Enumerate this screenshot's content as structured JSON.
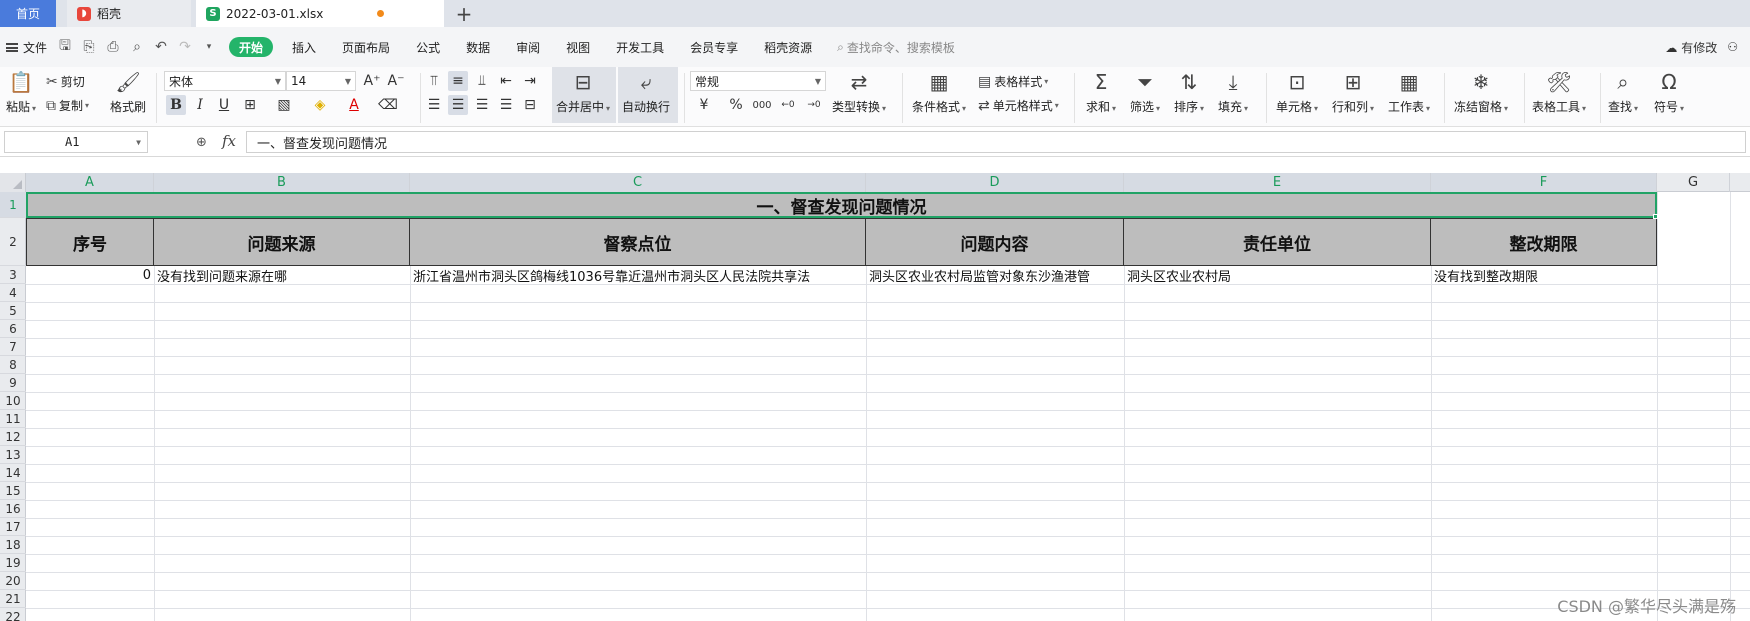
{
  "tabs": {
    "home": "首页",
    "daoke": "稻壳",
    "file": "2022-03-01.xlsx",
    "add": "+"
  },
  "menu": {
    "file": "文件",
    "items": [
      "开始",
      "插入",
      "页面布局",
      "公式",
      "数据",
      "审阅",
      "视图",
      "开发工具",
      "会员专享",
      "稻壳资源"
    ],
    "search": "查找命令、搜索模板",
    "modified": "有修改"
  },
  "ribbon": {
    "paste": "粘贴",
    "cut": "剪切",
    "copy": "复制",
    "format_painter": "格式刷",
    "font_name": "宋体",
    "font_size": "14",
    "merge_center": "合并居中",
    "wrap_text": "自动换行",
    "number_format": "常规",
    "type_convert": "类型转换",
    "conditional_format": "条件格式",
    "table_style": "表格样式",
    "cell_style": "单元格样式",
    "sum": "求和",
    "filter": "筛选",
    "sort": "排序",
    "fill": "填充",
    "cell": "单元格",
    "row_col": "行和列",
    "worksheet": "工作表",
    "freeze": "冻结窗格",
    "table_tools": "表格工具",
    "find": "查找",
    "symbol": "符号",
    "percent": "%",
    "thousands": "000"
  },
  "formula": {
    "cell_ref": "A1",
    "fx": "fx",
    "content": "一、督查发现问题情况"
  },
  "columns": [
    "A",
    "B",
    "C",
    "D",
    "E",
    "F",
    "G"
  ],
  "rows": [
    "1",
    "2",
    "3",
    "4",
    "5",
    "6",
    "7",
    "8",
    "9",
    "10",
    "11",
    "12",
    "13",
    "14",
    "15",
    "16",
    "17",
    "18",
    "19",
    "20",
    "21",
    "22"
  ],
  "sheet": {
    "title": "一、督查发现问题情况",
    "headers": [
      "序号",
      "问题来源",
      "督察点位",
      "问题内容",
      "责任单位",
      "整改期限"
    ],
    "row3": [
      "0",
      "没有找到问题来源在哪",
      "浙江省温州市洞头区鸽梅线1036号靠近温州市洞头区人民法院共享法",
      "洞头区农业农村局监管对象东沙渔港管",
      "洞头区农业农村局",
      "没有找到整改期限"
    ]
  },
  "watermark": "CSDN @繁华尽头满是殇",
  "colors": {
    "accent_green": "#21a366",
    "active_menu": "#24b46a",
    "home_tab": "#4a7bdc",
    "header_fill": "#bdbdbd"
  }
}
